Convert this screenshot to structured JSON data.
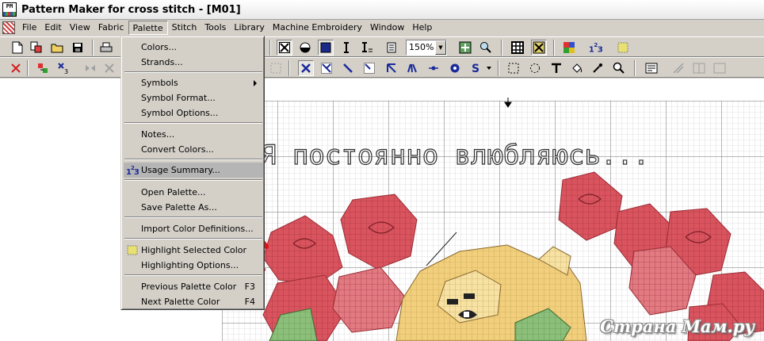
{
  "window": {
    "title": "Pattern Maker for cross stitch - [M01]"
  },
  "menubar": {
    "items": [
      "File",
      "Edit",
      "View",
      "Fabric",
      "Palette",
      "Stitch",
      "Tools",
      "Library",
      "Machine Embroidery",
      "Window",
      "Help"
    ],
    "open_index": 4
  },
  "toolbar": {
    "zoom_value": "150%"
  },
  "palette_menu": {
    "colors": "Colors...",
    "strands": "Strands...",
    "symbols": "Symbols",
    "symbol_format": "Symbol Format...",
    "symbol_options": "Symbol Options...",
    "notes": "Notes...",
    "convert_colors": "Convert Colors...",
    "usage_summary": "Usage Summary...",
    "open_palette": "Open Palette...",
    "save_palette_as": "Save Palette As...",
    "import_color_definitions": "Import Color Definitions...",
    "highlight_selected_color": "Highlight Selected Color",
    "highlighting_options": "Highlighting Options...",
    "previous_palette_color": "Previous Palette Color",
    "previous_shortcut": "F3",
    "next_palette_color": "Next Palette Color",
    "next_shortcut": "F4"
  },
  "pattern": {
    "heading_text": "Я постоянно влюбляюсь..."
  },
  "watermark": "Страна Мам.ру",
  "colors": {
    "menu_bg": "#d4d0c8",
    "highlight": "#b5b5b5",
    "rose": "#d9545e",
    "rose_dark": "#b83a45",
    "bear": "#f2cf7c",
    "leaf": "#8bbf7a",
    "arrow": "#e01010"
  }
}
